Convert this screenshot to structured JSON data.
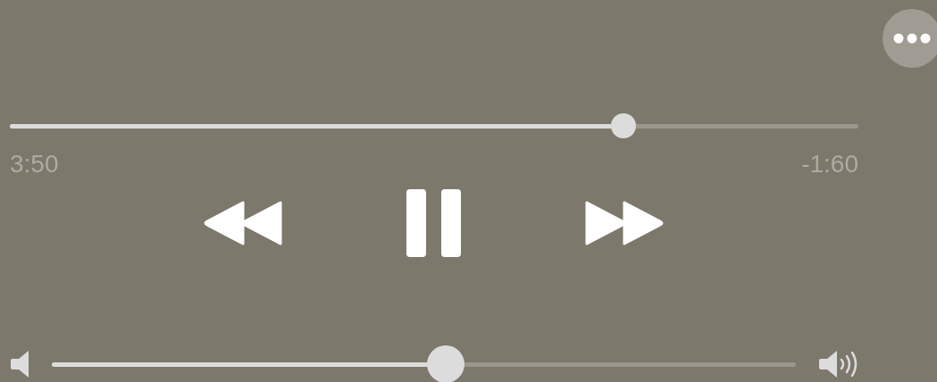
{
  "playback": {
    "level": 0.723,
    "elapsed": "3:50",
    "remaining": "-1:60",
    "playing": true
  },
  "volume": {
    "level": 0.529
  }
}
